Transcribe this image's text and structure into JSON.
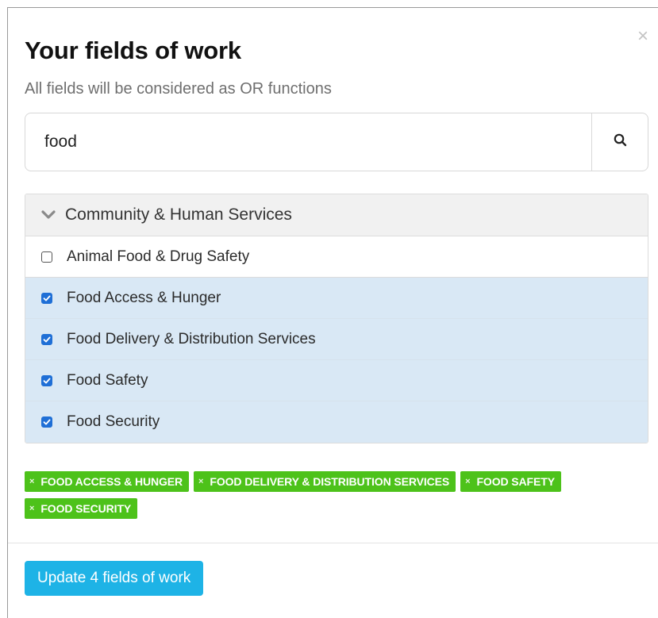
{
  "modal": {
    "title": "Your fields of work",
    "subtitle": "All fields will be considered as OR functions",
    "close_glyph": "×"
  },
  "search": {
    "value": "food",
    "icon": "search-icon"
  },
  "group": {
    "label": "Community & Human Services",
    "icon": "chevron-down-icon",
    "items": [
      {
        "label": "Animal Food & Drug Safety",
        "checked": false
      },
      {
        "label": "Food Access & Hunger",
        "checked": true
      },
      {
        "label": "Food Delivery & Distribution Services",
        "checked": true
      },
      {
        "label": "Food Safety",
        "checked": true
      },
      {
        "label": "Food Security",
        "checked": true
      }
    ]
  },
  "selected_tags": [
    {
      "label": "FOOD ACCESS & HUNGER"
    },
    {
      "label": "FOOD DELIVERY & DISTRIBUTION SERVICES"
    },
    {
      "label": "FOOD SAFETY"
    },
    {
      "label": "FOOD SECURITY"
    }
  ],
  "tag_remove_glyph": "×",
  "footer": {
    "update_label": "Update 4 fields of work"
  },
  "colors": {
    "tag_bg": "#4dc21a",
    "checked_row_bg": "#d9e8f5",
    "checkbox_on": "#1f6fd6",
    "primary_button": "#1eb3e6"
  }
}
